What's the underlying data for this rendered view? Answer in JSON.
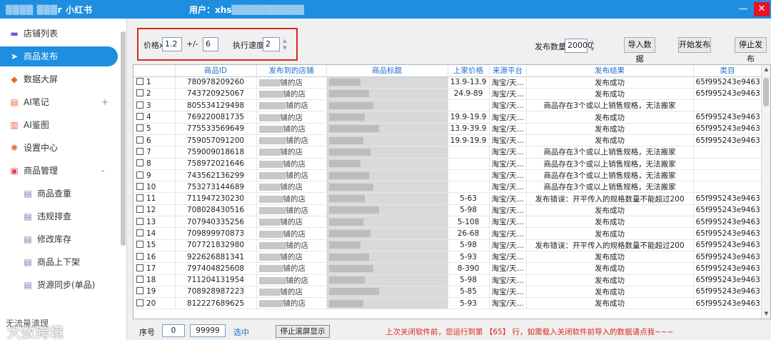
{
  "titlebar": {
    "app_title": "▒▒▒▒ ▒▒▒r 小红书",
    "user_label": "用户：xhs▒▒▒▒▒▒▒▒▒▒▒",
    "minimize": "—",
    "close": "✕"
  },
  "sidebar": {
    "items": [
      {
        "label": "店铺列表",
        "icon": "store-icon",
        "glyph": "▬"
      },
      {
        "label": "商品发布",
        "icon": "send-icon",
        "glyph": "➤"
      },
      {
        "label": "数据大屏",
        "icon": "diamond-icon",
        "glyph": "◆"
      },
      {
        "label": "AI笔记",
        "icon": "note-icon",
        "glyph": "▤",
        "expand": "+"
      },
      {
        "label": "AI鉴图",
        "icon": "trash-icon",
        "glyph": "▥"
      },
      {
        "label": "设置中心",
        "icon": "gear-icon",
        "glyph": "✺"
      },
      {
        "label": "商品管理",
        "icon": "bag-icon",
        "glyph": "▣",
        "expand": "-"
      },
      {
        "label": "商品查重",
        "icon": "list-icon",
        "glyph": "▤"
      },
      {
        "label": "违规排查",
        "icon": "list-icon",
        "glyph": "▤"
      },
      {
        "label": "修改库存",
        "icon": "list-icon",
        "glyph": "▤"
      },
      {
        "label": "商品上下架",
        "icon": "list-icon",
        "glyph": "▤"
      },
      {
        "label": "货源同步(单品)",
        "icon": "list-icon",
        "glyph": "▤"
      }
    ],
    "footer_text": "无流量清理",
    "watermark": "大数跨境"
  },
  "toolbar": {
    "price_label": "价格x",
    "price_multiplier": "1.2",
    "plusminus_label": "+/-",
    "plusminus_value": "6",
    "speed_label": "执行速度",
    "speed_value": "2",
    "publish_count_label": "发布数量",
    "publish_count_value": "20000",
    "import_button": "导入数据",
    "start_button": "开始发布",
    "stop_button": "停止发布"
  },
  "table": {
    "columns": [
      "",
      "商品ID",
      "发布到的店铺",
      "商品标题",
      "上家价格",
      "来源平台",
      "发布结果",
      "类目"
    ],
    "rows": [
      {
        "n": "1",
        "id": "780978209260",
        "shop": "铺的店",
        "price": "13.9-13.9",
        "src": "淘宝/天...",
        "result": "发布成功",
        "cat": "65f995243e9463..."
      },
      {
        "n": "2",
        "id": "743720925067",
        "shop": "铺的店",
        "price": "24.9-89",
        "src": "淘宝/天...",
        "result": "发布成功",
        "cat": "65f995243e9463..."
      },
      {
        "n": "3",
        "id": "805534129498",
        "shop": "铺的店",
        "price": "",
        "src": "淘宝/天...",
        "result": "商品存在3个或以上销售规格，无法搬家",
        "cat": ""
      },
      {
        "n": "4",
        "id": "769220081735",
        "shop": "铺的店",
        "price": "19.9-19.9",
        "src": "淘宝/天...",
        "result": "发布成功",
        "cat": "65f995243e9463..."
      },
      {
        "n": "5",
        "id": "775533569649",
        "shop": "铺的店",
        "price": "13.9-39.9",
        "src": "淘宝/天...",
        "result": "发布成功",
        "cat": "65f995243e9463..."
      },
      {
        "n": "6",
        "id": "759057091200",
        "shop": "铺的店",
        "price": "19.9-19.9",
        "src": "淘宝/天...",
        "result": "发布成功",
        "cat": "65f995243e9463..."
      },
      {
        "n": "7",
        "id": "759009018618",
        "shop": "铺的店",
        "price": "",
        "src": "淘宝/天...",
        "result": "商品存在3个或以上销售规格，无法搬家",
        "cat": ""
      },
      {
        "n": "8",
        "id": "758972021646",
        "shop": "铺的店",
        "price": "",
        "src": "淘宝/天...",
        "result": "商品存在3个或以上销售规格，无法搬家",
        "cat": ""
      },
      {
        "n": "9",
        "id": "743562136299",
        "shop": "铺的店",
        "price": "",
        "src": "淘宝/天...",
        "result": "商品存在3个或以上销售规格，无法搬家",
        "cat": ""
      },
      {
        "n": "10",
        "id": "753273144689",
        "shop": "铺的店",
        "price": "",
        "src": "淘宝/天...",
        "result": "商品存在3个或以上销售规格，无法搬家",
        "cat": ""
      },
      {
        "n": "11",
        "id": "711947230230",
        "shop": "铺的店",
        "price": "5-63",
        "src": "淘宝/天...",
        "result": "发布错误：开平传入的规格数量不能超过200",
        "cat": "65f995243e9463..."
      },
      {
        "n": "12",
        "id": "708028430516",
        "shop": "铺的店",
        "price": "5-98",
        "src": "淘宝/天...",
        "result": "发布成功",
        "cat": "65f995243e9463..."
      },
      {
        "n": "13",
        "id": "707940335256",
        "shop": "铺的店",
        "price": "5-108",
        "src": "淘宝/天...",
        "result": "发布成功",
        "cat": "65f995243e9463..."
      },
      {
        "n": "14",
        "id": "709899970873",
        "shop": "铺的店",
        "price": "26-68",
        "src": "淘宝/天...",
        "result": "发布成功",
        "cat": "65f995243e9463..."
      },
      {
        "n": "15",
        "id": "707721832980",
        "shop": "铺的店",
        "price": "5-98",
        "src": "淘宝/天...",
        "result": "发布错误：开平传入的规格数量不能超过200",
        "cat": "65f995243e9463..."
      },
      {
        "n": "16",
        "id": "922626881341",
        "shop": "铺的店",
        "price": "5-93",
        "src": "淘宝/天...",
        "result": "发布成功",
        "cat": "65f995243e9463..."
      },
      {
        "n": "17",
        "id": "797404825608",
        "shop": "铺的店",
        "price": "8-390",
        "src": "淘宝/天...",
        "result": "发布成功",
        "cat": "65f995243e9463..."
      },
      {
        "n": "18",
        "id": "711204131954",
        "shop": "铺的店",
        "price": "5-98",
        "src": "淘宝/天...",
        "result": "发布成功",
        "cat": "65f995243e9463..."
      },
      {
        "n": "19",
        "id": "708928987223",
        "shop": "铺的店",
        "price": "5-85",
        "src": "淘宝/天...",
        "result": "发布成功",
        "cat": "65f995243e9463..."
      },
      {
        "n": "20",
        "id": "812227689625",
        "shop": "铺的店",
        "price": "5-93",
        "src": "淘宝/天...",
        "result": "发布成功",
        "cat": "65f995243e9463..."
      }
    ]
  },
  "footer": {
    "seq_label": "序号",
    "seq_from": "0",
    "seq_to": "99999",
    "select_link": "选中",
    "stop_scroll_button": "停止滚屏显示",
    "notice": "上次关闭软件前，您运行到第 【65】 行，如需载入关闭软件前导入的数据请点我~~~"
  },
  "colors": {
    "accent": "#1e8fe0",
    "highlight_border": "#d9261c",
    "notice_text": "#d9261c",
    "header_text": "#1e6fc8"
  }
}
